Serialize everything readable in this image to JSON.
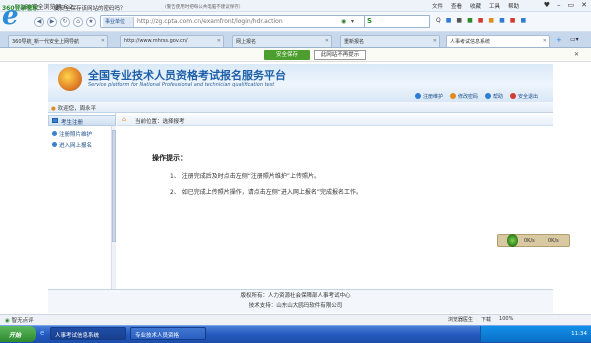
{
  "browser": {
    "window_title": "360安全浏览器 6.2",
    "menus": [
      "文件",
      "查看",
      "收藏",
      "工具",
      "帮助"
    ],
    "window_controls": [
      "♥",
      "–",
      "▭",
      "✕"
    ],
    "nav": {
      "back": "◀",
      "forward": "▶",
      "refresh": "↻",
      "home": "⌂",
      "favorite": "★"
    },
    "address_selector": "事业单位",
    "url": "http://zg.cpta.com.cn/examfront/login/hdr.action",
    "search_placeholder": "",
    "tools": [
      "Q",
      "■",
      "■",
      "■",
      "■",
      "■",
      "■",
      "■",
      "■"
    ]
  },
  "tabs": [
    {
      "label": "360导航_新一代安全上网导航"
    },
    {
      "label": "http://www.mhrss.gov.cn/"
    },
    {
      "label": "网上报名"
    },
    {
      "label": "重新报名"
    },
    {
      "label": "人事考试信息系统",
      "active": true
    }
  ],
  "notify": {
    "brand": "360登录管家",
    "message": "要安全保存该网站的密码吗？",
    "sub": "(警告使用时把每公共电脑不建议保存）",
    "save_button": "安全保存",
    "never_button": "此网站不再提示",
    "close": "✕"
  },
  "site": {
    "title": "全国专业技术人员资格考试报名服务平台",
    "subtitle": "Service platform for National Professional and technician qualification test",
    "links": [
      {
        "label": "注册维护",
        "color": "#2d7dd2"
      },
      {
        "label": "修改密码",
        "color": "#e08a1f"
      },
      {
        "label": "帮助",
        "color": "#2d7dd2"
      },
      {
        "label": "安全退出",
        "color": "#d43a2f"
      }
    ],
    "welcome": "欢迎您，周永平",
    "left_header": "考生注册",
    "left_items": [
      "注册照片维护",
      "进入网上报名"
    ],
    "breadcrumb": "当前位置：选择报考",
    "op_title": "操作提示：",
    "steps": [
      "1、  注册完成后及时点击左侧“注册照片维护”上传照片。",
      "2、  如已完成上传照片操作，请点击左侧“进入网上报名”完成报名工作。"
    ],
    "widget": {
      "left": "0K/s",
      "right": "0K/s"
    },
    "footer": {
      "copyright": "版权所有：人力资源社会保障部人事考试中心",
      "support": "技术支持：山东山大鸥玛软件有限公司"
    }
  },
  "statusbar": {
    "left": "智无点评",
    "right": [
      "浏览器医生",
      "下载",
      "100%"
    ]
  },
  "taskbar": {
    "start": "开始",
    "tasks": [
      "人事考试信息系统",
      "专业技术人员资格"
    ],
    "clock": "11:34"
  }
}
